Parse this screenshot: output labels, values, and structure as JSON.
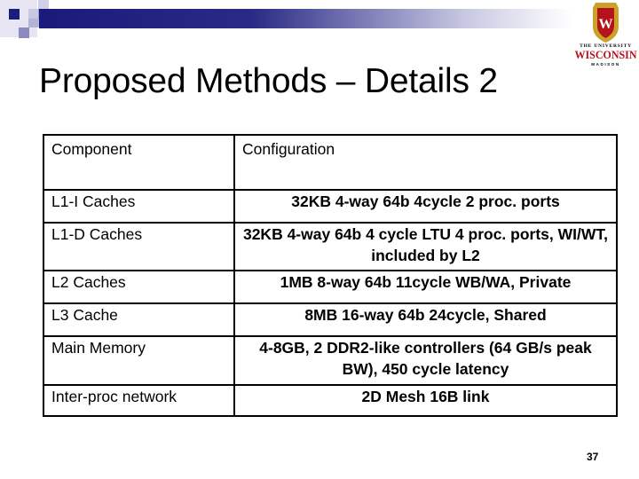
{
  "slide": {
    "title": "Proposed Methods – Details 2",
    "page_number": "37",
    "logo": {
      "line1": "THE UNIVERSITY",
      "line2": "WISCONSIN",
      "line3": "MADISON",
      "crest_letter": "W"
    },
    "colors": {
      "accent_navy": "#1f1f7a",
      "crest_red": "#b5121b",
      "crest_gold": "#c9a227"
    }
  },
  "table": {
    "headers": [
      "Component",
      "Configuration"
    ],
    "rows": [
      {
        "component": "L1-I Caches",
        "configuration": "32KB 4-way 64b 4cycle 2 proc. ports"
      },
      {
        "component": "L1-D Caches",
        "configuration": "32KB 4-way 64b 4 cycle LTU 4 proc. ports, WI/WT, included by L2"
      },
      {
        "component": "L2 Caches",
        "configuration": "1MB 8-way 64b 11cycle WB/WA, Private"
      },
      {
        "component": "L3 Cache",
        "configuration": "8MB 16-way 64b 24cycle, Shared"
      },
      {
        "component": "Main Memory",
        "configuration": "4-8GB, 2 DDR2-like controllers (64 GB/s peak BW), 450 cycle latency"
      },
      {
        "component": "Inter-proc network",
        "configuration": "2D Mesh 16B link"
      }
    ]
  }
}
